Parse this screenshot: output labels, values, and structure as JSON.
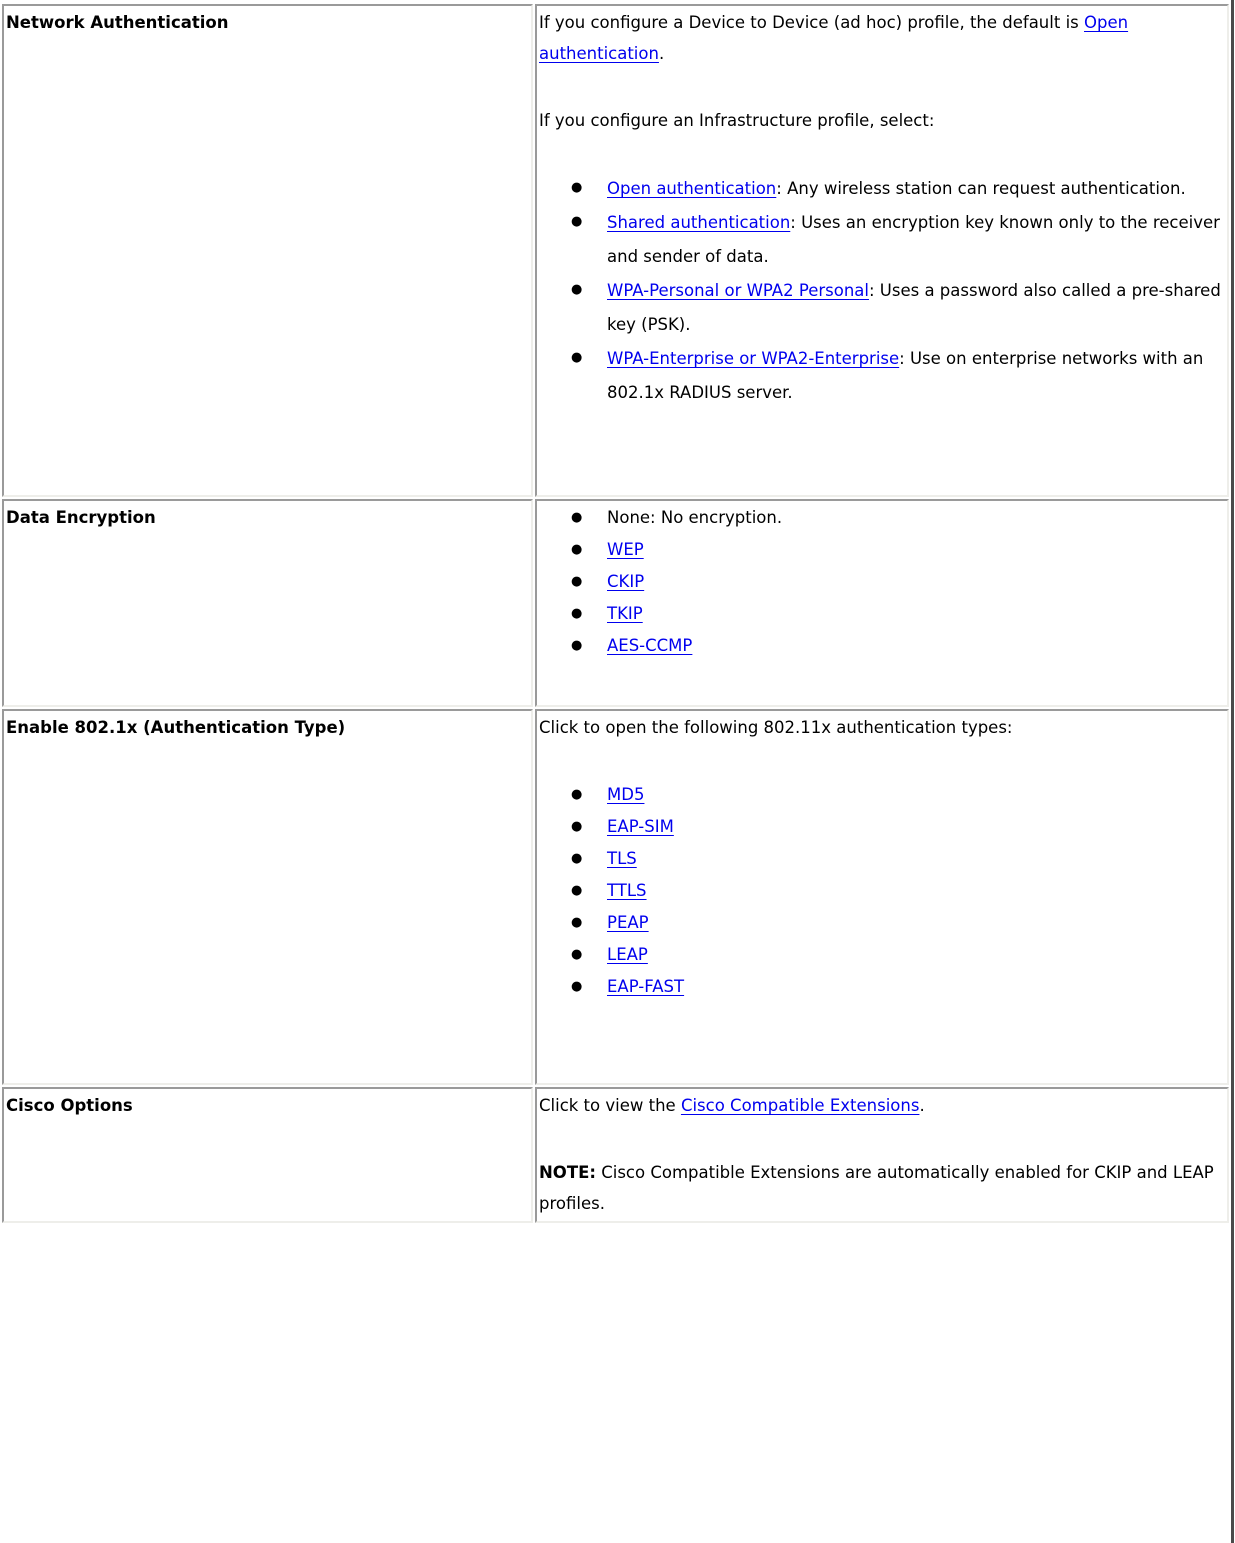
{
  "table": {
    "rows": [
      {
        "label": "Network Authentication",
        "intro_text": "If you configure a Device to Device (ad hoc) profile, the default is ",
        "intro_link": "Open authentication",
        "intro_end": ".",
        "select_text": "If you configure an Infrastructure profile, select:",
        "items": [
          {
            "link": "Open authentication",
            "text": ": Any wireless station can request authentication."
          },
          {
            "link": "Shared authentication",
            "text": ": Uses an encryption key known only to the receiver and sender of data."
          },
          {
            "link": "WPA-Personal or WPA2 Personal",
            "text": ": Uses a password also called a pre-shared key (PSK)."
          },
          {
            "link": "WPA-Enterprise or WPA2-Enterprise",
            "text": ": Use on enterprise networks with an 802.1x RADIUS server."
          }
        ]
      },
      {
        "label": "Data Encryption",
        "plain_item": "None: No encryption.",
        "items": [
          "WEP",
          "CKIP",
          "TKIP",
          "AES-CCMP"
        ]
      },
      {
        "label": "Enable 802.1x (Authentication Type)",
        "intro_text": "Click to open the following 802.11x authentication types:",
        "items": [
          "MD5",
          "EAP-SIM",
          "TLS",
          "TTLS",
          "PEAP",
          "LEAP",
          "EAP-FAST"
        ]
      },
      {
        "label": "Cisco Options",
        "intro_text": "Click to view the ",
        "intro_link": "Cisco Compatible Extensions",
        "intro_end": ".",
        "note_label": "NOTE:",
        "note_text": " Cisco Compatible Extensions are automatically enabled for CKIP and LEAP profiles."
      }
    ]
  },
  "icons": {
    "bullet": "●"
  },
  "colors": {
    "link": "#0000EE",
    "text": "#000000",
    "border_dark": "#9A9A9A",
    "border_light": "#EEEEEA"
  }
}
